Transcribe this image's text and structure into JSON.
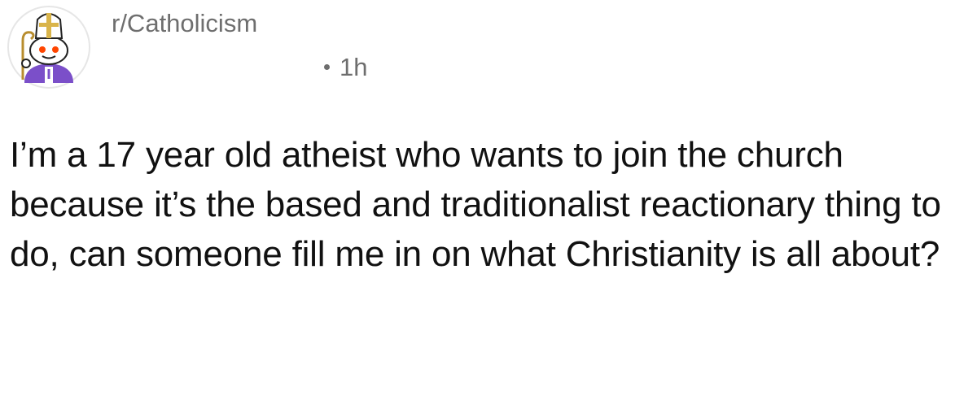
{
  "post": {
    "subreddit": "r/Catholicism",
    "time_ago": "1h",
    "avatar_icon": "catholic-snoo-mitre-icon",
    "title": "I’m a 17 year old atheist who wants to join the church because it’s the based and traditionalist reactionary thing to do, can someone fill me in on what Christianity is all about?"
  },
  "colors": {
    "text": "#111111",
    "meta": "#6e6e6e",
    "avatar_purple": "#7b4fc9",
    "mitre_gold": "#d9b44a",
    "snoo_eyes": "#ff4500"
  }
}
